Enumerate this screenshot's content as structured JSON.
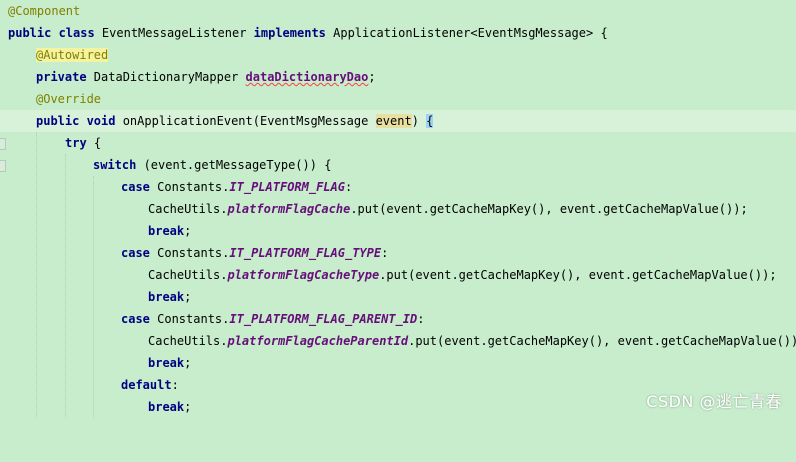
{
  "colors": {
    "background": "#c7edcc",
    "current_line": "#d7f2d9",
    "keyword": "#000080",
    "annotation": "#808000",
    "field": "#660e7a"
  },
  "code": {
    "l1": {
      "annotation": "@Component"
    },
    "l2": {
      "kw1": "public class",
      "t1": " EventMessageListener ",
      "kw2": "implements",
      "t2": " ApplicationListener<EventMsgMessage> {"
    },
    "l3": {
      "annotation": "@Autowired"
    },
    "l4": {
      "kw1": "private",
      "t1": " DataDictionaryMapper ",
      "field": "dataDictionaryDao",
      "t2": ";"
    },
    "l5": {
      "annotation": "@Override"
    },
    "l6": {
      "kw1": "public void",
      "t1": " onApplicationEvent(EventMsgMessage ",
      "param": "event",
      "t2": ") ",
      "brace": "{"
    },
    "l7": {
      "kw1": "try",
      "t1": " {"
    },
    "l8": {
      "kw1": "switch",
      "t1": " (event.getMessageType()) {"
    },
    "l9": {
      "kw1": "case",
      "t1": " Constants.",
      "sfield": "IT_PLATFORM_FLAG",
      "t2": ":"
    },
    "l10": {
      "t1": "CacheUtils.",
      "sfield": "platformFlagCache",
      "t2": ".put(event.getCacheMapKey(), event.getCacheMapValue());"
    },
    "l11": {
      "kw1": "break",
      "t1": ";"
    },
    "l12": {
      "kw1": "case",
      "t1": " Constants.",
      "sfield": "IT_PLATFORM_FLAG_TYPE",
      "t2": ":"
    },
    "l13": {
      "t1": "CacheUtils.",
      "sfield": "platformFlagCacheType",
      "t2": ".put(event.getCacheMapKey(), event.getCacheMapValue());"
    },
    "l14": {
      "kw1": "break",
      "t1": ";"
    },
    "l15": {
      "kw1": "case",
      "t1": " Constants.",
      "sfield": "IT_PLATFORM_FLAG_PARENT_ID",
      "t2": ":"
    },
    "l16": {
      "t1": "CacheUtils.",
      "sfield": "platformFlagCacheParentId",
      "t2": ".put(event.getCacheMapKey(), event.getCacheMapValue());"
    },
    "l17": {
      "kw1": "break",
      "t1": ";"
    },
    "l18": {
      "kw1": "default",
      "t1": ":"
    },
    "l19": {
      "kw1": "break",
      "t1": ";"
    }
  },
  "watermark": "CSDN @逃亡青春"
}
